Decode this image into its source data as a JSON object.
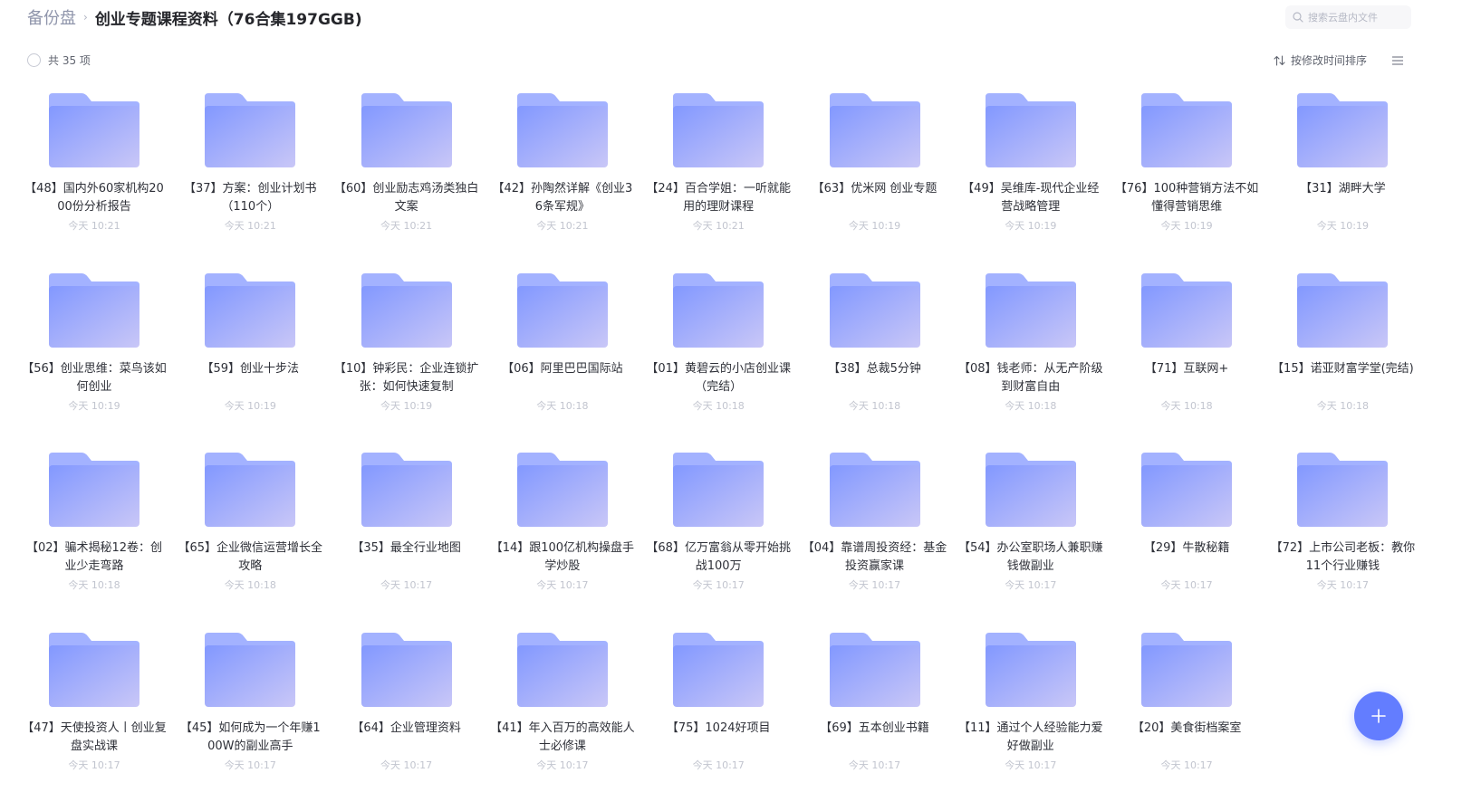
{
  "breadcrumb": {
    "root": "备份盘",
    "separator": "›",
    "current": "创业专题课程资料（76合集197GGB)"
  },
  "search": {
    "placeholder": "搜索云盘内文件",
    "value": "",
    "icon": "search-icon"
  },
  "toolbar": {
    "count_label": "共 35 项",
    "sort_label": "按修改时间排序",
    "sort_icon": "sort-icon",
    "view_icon": "list-view-icon"
  },
  "colors": {
    "accent": "#637dff",
    "folder_front_start": "#8298ff",
    "folder_front_end": "#c9c7f7",
    "folder_back": "#a3b2ff"
  },
  "folders": [
    {
      "name": "【48】国内外60家机构2000份分析报告",
      "time": "今天 10:21"
    },
    {
      "name": "【37】方案：创业计划书（110个）",
      "time": "今天 10:21"
    },
    {
      "name": "【60】创业励志鸡汤类独白文案",
      "time": "今天 10:21"
    },
    {
      "name": "【42】孙陶然详解《创业36条军规》",
      "time": "今天 10:21"
    },
    {
      "name": "【24】百合学姐：一听就能用的理财课程",
      "time": "今天 10:21"
    },
    {
      "name": "【63】优米网 创业专题",
      "time": "今天 10:19"
    },
    {
      "name": "【49】吴维库-现代企业经营战略管理",
      "time": "今天 10:19"
    },
    {
      "name": "【76】100种营销方法不如懂得营销思维",
      "time": "今天 10:19"
    },
    {
      "name": "【31】湖畔大学",
      "time": "今天 10:19"
    },
    {
      "name": "【56】创业思维：菜鸟该如何创业",
      "time": "今天 10:19"
    },
    {
      "name": "【59】创业十步法",
      "time": "今天 10:19"
    },
    {
      "name": "【10】钟彩民：企业连锁扩张：如何快速复制",
      "time": "今天 10:19"
    },
    {
      "name": "【06】阿里巴巴国际站",
      "time": "今天 10:18"
    },
    {
      "name": "【01】黄碧云的小店创业课（完结）",
      "time": "今天 10:18"
    },
    {
      "name": "【38】总裁5分钟",
      "time": "今天 10:18"
    },
    {
      "name": "【08】钱老师：从无产阶级到财富自由",
      "time": "今天 10:18"
    },
    {
      "name": "【71】互联网+",
      "time": "今天 10:18"
    },
    {
      "name": "【15】诺亚财富学堂(完结)",
      "time": "今天 10:18"
    },
    {
      "name": "【02】骗术揭秘12卷：创业少走弯路",
      "time": "今天 10:18"
    },
    {
      "name": "【65】企业微信运营增长全攻略",
      "time": "今天 10:18"
    },
    {
      "name": "【35】最全行业地图",
      "time": "今天 10:17"
    },
    {
      "name": "【14】跟100亿机构操盘手学炒股",
      "time": "今天 10:17"
    },
    {
      "name": "【68】亿万富翁从零开始挑战100万",
      "time": "今天 10:17"
    },
    {
      "name": "【04】靠谱周投资经：基金投资赢家课",
      "time": "今天 10:17"
    },
    {
      "name": "【54】办公室职场人兼职赚钱做副业",
      "time": "今天 10:17"
    },
    {
      "name": "【29】牛散秘籍",
      "time": "今天 10:17"
    },
    {
      "name": "【72】上市公司老板：教你11个行业赚钱",
      "time": "今天 10:17"
    },
    {
      "name": "【47】天使投资人丨创业复盘实战课",
      "time": "今天 10:17"
    },
    {
      "name": "【45】如何成为一个年赚100W的副业高手",
      "time": "今天 10:17"
    },
    {
      "name": "【64】企业管理资料",
      "time": "今天 10:17"
    },
    {
      "name": "【41】年入百万的高效能人士必修课",
      "time": "今天 10:17"
    },
    {
      "name": "【75】1024好项目",
      "time": "今天 10:17"
    },
    {
      "name": "【69】五本创业书籍",
      "time": "今天 10:17"
    },
    {
      "name": "【11】通过个人经验能力爱好做副业",
      "time": "今天 10:17"
    },
    {
      "name": "【20】美食街档案室",
      "time": "今天 10:17"
    }
  ],
  "fab": {
    "icon": "plus-icon"
  }
}
